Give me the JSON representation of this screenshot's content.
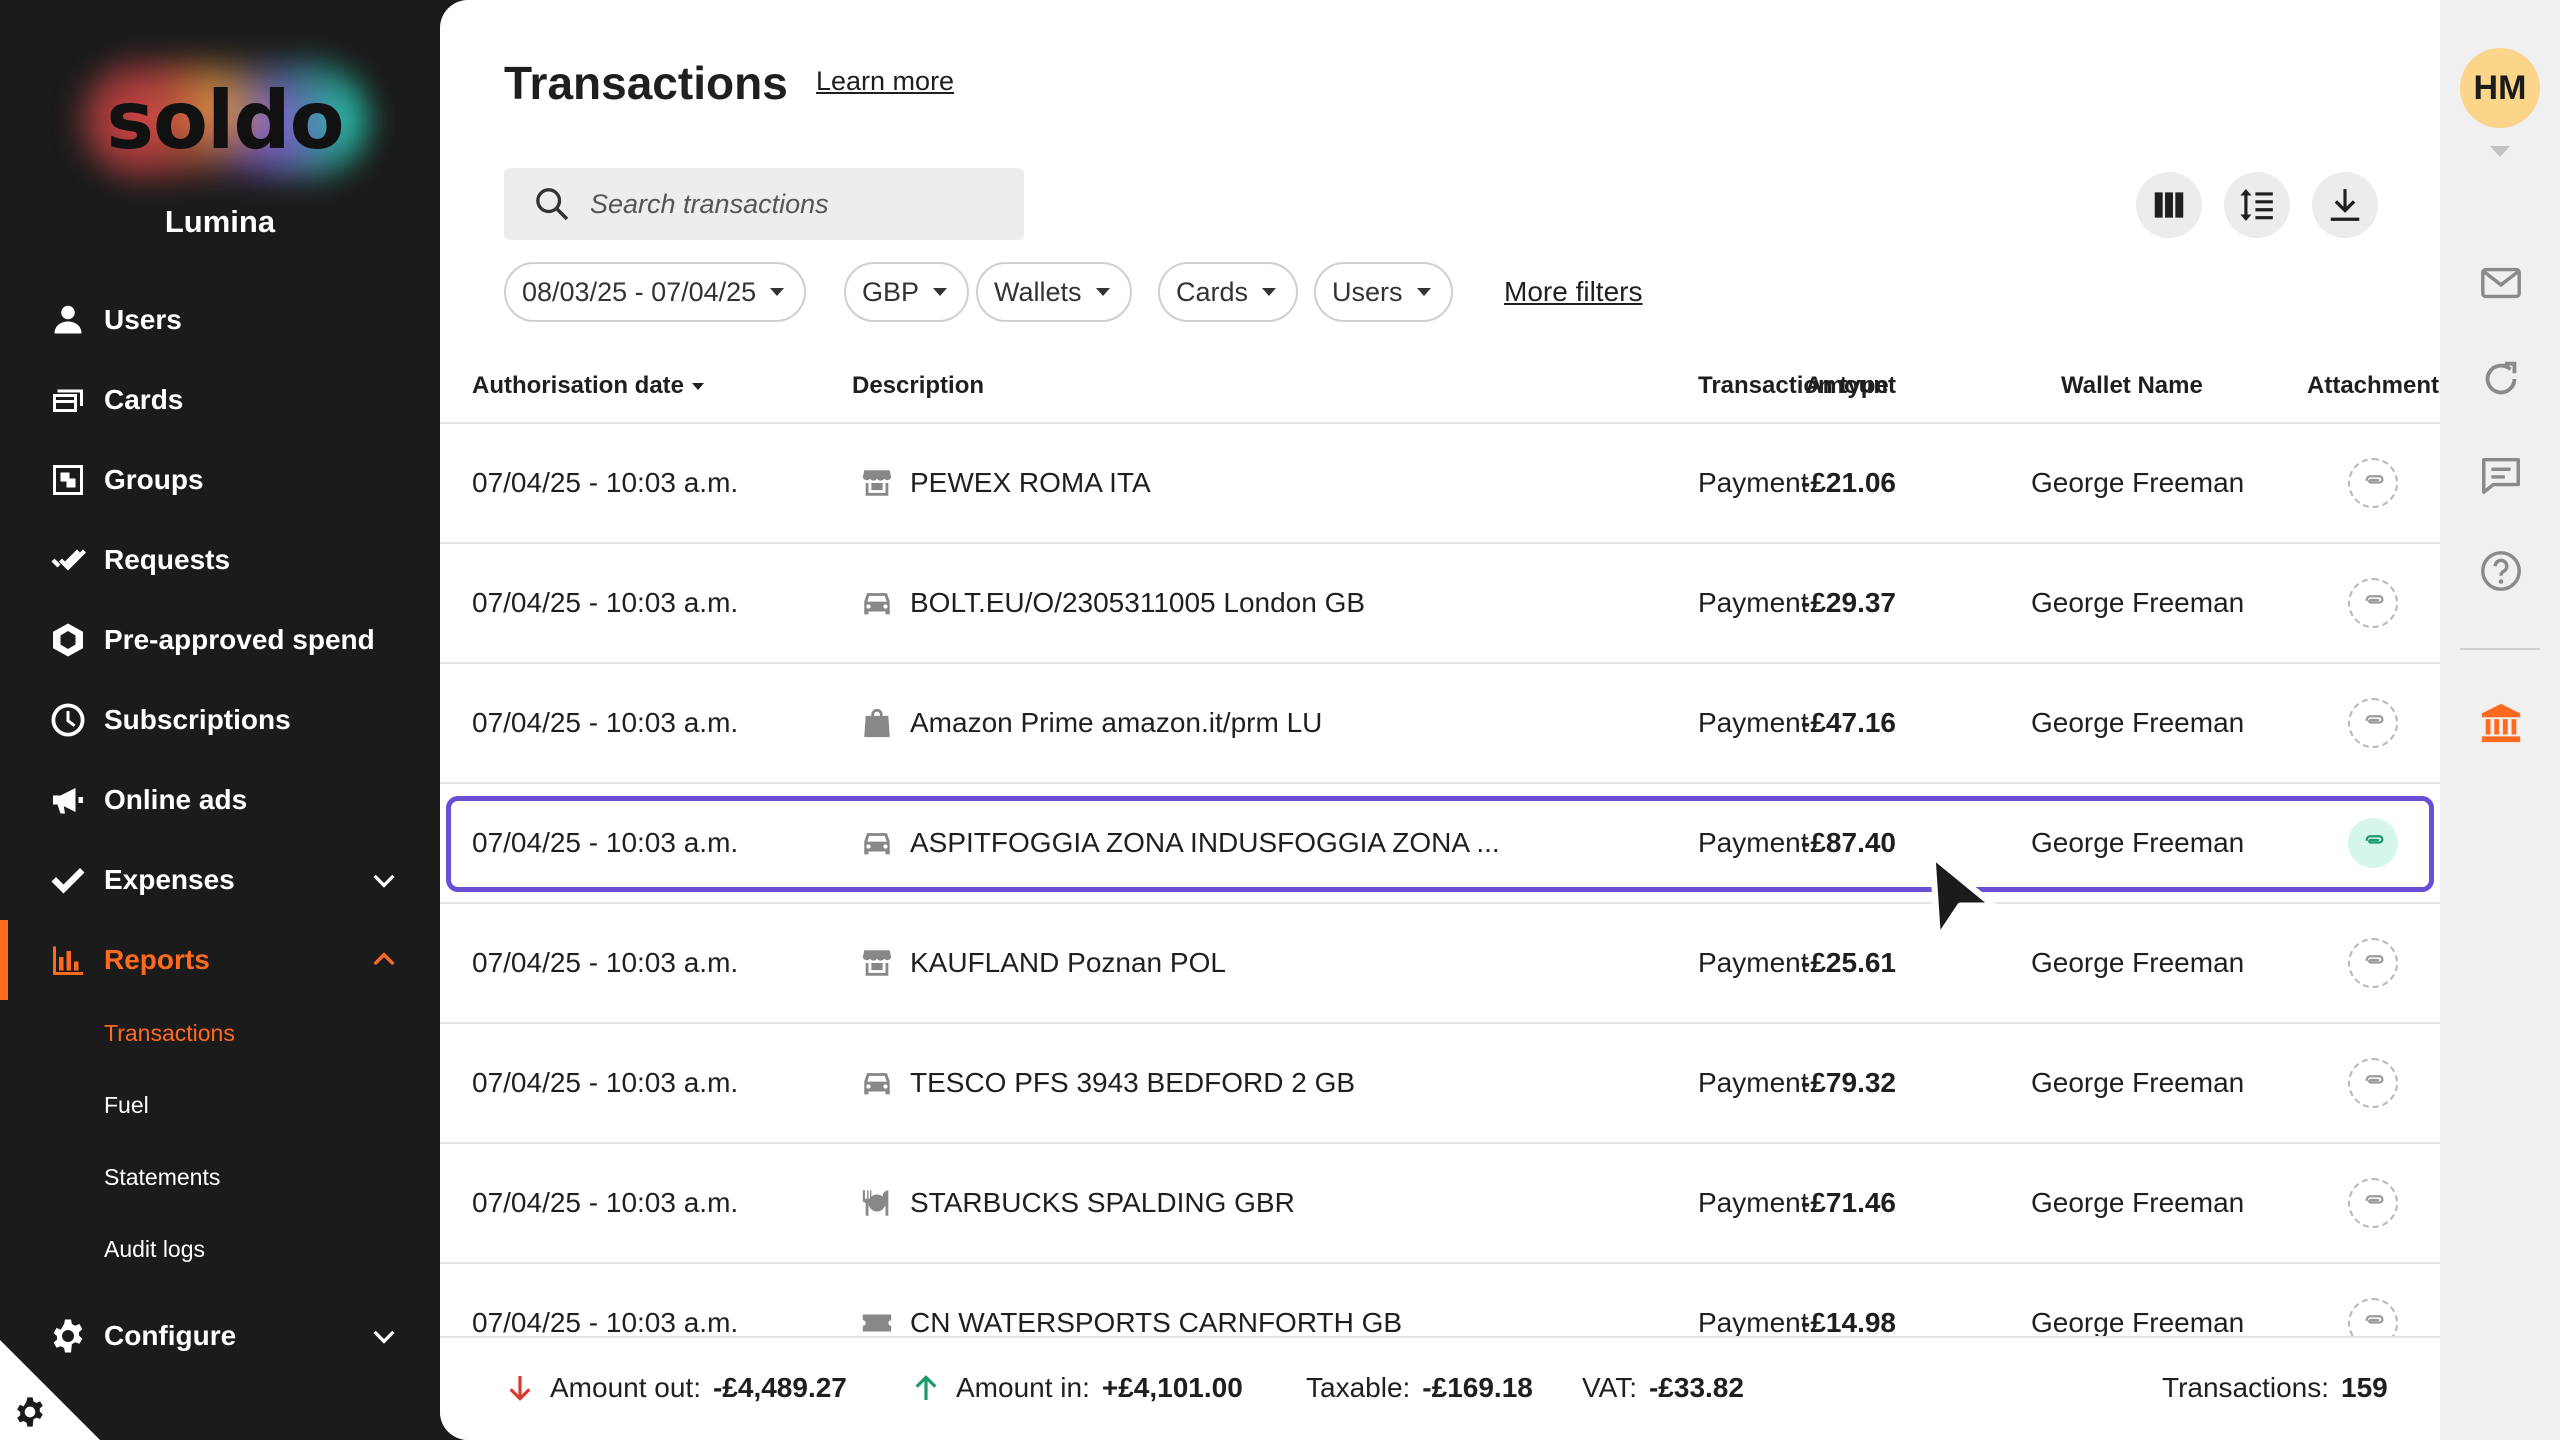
{
  "sidebar": {
    "logo_text": "soldo",
    "org_name": "Lumina",
    "items": [
      {
        "label": "Users",
        "icon": "user-icon"
      },
      {
        "label": "Cards",
        "icon": "cards-icon"
      },
      {
        "label": "Groups",
        "icon": "groups-icon"
      },
      {
        "label": "Requests",
        "icon": "double-check-icon"
      },
      {
        "label": "Pre-approved spend",
        "icon": "hexagon-icon"
      },
      {
        "label": "Subscriptions",
        "icon": "clock-icon"
      },
      {
        "label": "Online ads",
        "icon": "megaphone-icon"
      },
      {
        "label": "Expenses",
        "icon": "check-icon"
      },
      {
        "label": "Reports",
        "icon": "bar-chart-icon"
      },
      {
        "label": "Configure",
        "icon": "gear-icon"
      }
    ],
    "report_subitems": [
      "Transactions",
      "Fuel",
      "Statements",
      "Audit logs"
    ],
    "active_item": "Reports",
    "active_subitem": "Transactions"
  },
  "header": {
    "title": "Transactions",
    "learn_more": "Learn more"
  },
  "search": {
    "placeholder": "Search transactions"
  },
  "filters": {
    "date_range": "08/03/25 - 07/04/25",
    "currency": "GBP",
    "wallets": "Wallets",
    "cards": "Cards",
    "users": "Users",
    "more_filters": "More filters"
  },
  "table": {
    "columns": [
      "Authorisation date",
      "Description",
      "Amount",
      "Transaction type",
      "Wallet Name",
      "Attachment"
    ],
    "rows": [
      {
        "date": "07/04/25 - 10:03 a.m.",
        "description": "PEWEX ROMA ITA",
        "category_icon": "store-icon",
        "amount": "-£21.06",
        "type": "Payment",
        "wallet": "George Freeman",
        "attachment": false
      },
      {
        "date": "07/04/25 - 10:03 a.m.",
        "description": "BOLT.EU/O/2305311005 London GB",
        "category_icon": "car-icon",
        "amount": "-£29.37",
        "type": "Payment",
        "wallet": "George Freeman",
        "attachment": false
      },
      {
        "date": "07/04/25 - 10:03 a.m.",
        "description": "Amazon Prime amazon.it/prm LU",
        "category_icon": "shopping-bag-icon",
        "amount": "-£47.16",
        "type": "Payment",
        "wallet": "George Freeman",
        "attachment": false
      },
      {
        "date": "07/04/25 - 10:03 a.m.",
        "description": "ASPITFOGGIA ZONA INDUSFOGGIA ZONA ...",
        "category_icon": "car-icon",
        "amount": "-£87.40",
        "type": "Payment",
        "wallet": "George Freeman",
        "attachment": true
      },
      {
        "date": "07/04/25 - 10:03 a.m.",
        "description": "KAUFLAND Poznan POL",
        "category_icon": "store-icon",
        "amount": "-£25.61",
        "type": "Payment",
        "wallet": "George Freeman",
        "attachment": false
      },
      {
        "date": "07/04/25 - 10:03 a.m.",
        "description": "TESCO PFS 3943 BEDFORD 2 GB",
        "category_icon": "car-icon",
        "amount": "-£79.32",
        "type": "Payment",
        "wallet": "George Freeman",
        "attachment": false
      },
      {
        "date": "07/04/25 - 10:03 a.m.",
        "description": "STARBUCKS SPALDING GBR",
        "category_icon": "restaurant-icon",
        "amount": "-£71.46",
        "type": "Payment",
        "wallet": "George Freeman",
        "attachment": false
      },
      {
        "date": "07/04/25 - 10:03 a.m.",
        "description": "CN WATERSPORTS CARNFORTH GB",
        "category_icon": "ticket-icon",
        "amount": "-£14.98",
        "type": "Payment",
        "wallet": "George Freeman",
        "attachment": false
      }
    ]
  },
  "summary": {
    "amount_out_label": "Amount out:",
    "amount_out": "-£4,489.27",
    "amount_in_label": "Amount in:",
    "amount_in": "+£4,101.00",
    "taxable_label": "Taxable:",
    "taxable": "-£169.18",
    "vat_label": "VAT:",
    "vat": "-£33.82",
    "count_label": "Transactions:",
    "count": "159"
  },
  "rail": {
    "avatar_initials": "HM",
    "icons": [
      "mail-icon",
      "refresh-icon",
      "chat-icon",
      "help-icon",
      "bank-icon"
    ]
  },
  "colors": {
    "accent": "#ff6a1f",
    "highlight_border": "#6a4fd6",
    "attachment_bg": "#d6f5ec",
    "sidebar_bg": "#1b1b1b",
    "avatar_bg": "#fbd58a"
  }
}
